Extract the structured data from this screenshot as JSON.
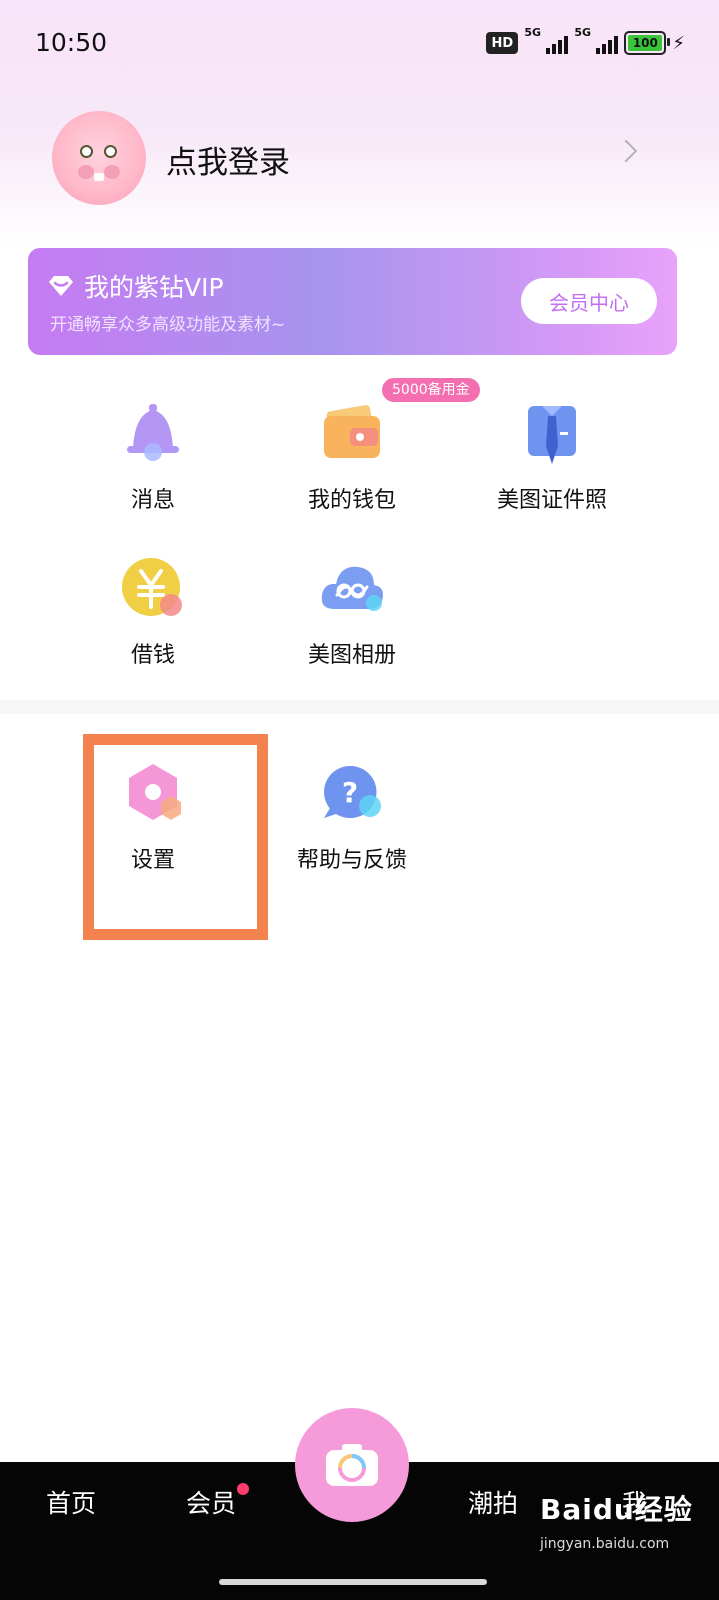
{
  "status_bar": {
    "time": "10:50",
    "hd": "HD",
    "net1": "5G",
    "net2": "5G",
    "battery": "100"
  },
  "profile": {
    "login_text": "点我登录"
  },
  "vip": {
    "title": "我的紫钻VIP",
    "subtitle": "开通畅享众多高级功能及素材~",
    "button": "会员中心"
  },
  "grid": {
    "wallet_badge": "5000备用金",
    "items": [
      {
        "label": "消息",
        "icon": "bell-icon"
      },
      {
        "label": "我的钱包",
        "icon": "wallet-icon"
      },
      {
        "label": "美图证件照",
        "icon": "id-photo-icon"
      },
      {
        "label": "借钱",
        "icon": "yen-coin-icon"
      },
      {
        "label": "美图相册",
        "icon": "cloud-album-icon"
      }
    ]
  },
  "tools": {
    "items": [
      {
        "label": "设置",
        "icon": "settings-icon"
      },
      {
        "label": "帮助与反馈",
        "icon": "help-icon"
      }
    ]
  },
  "bottom_nav": {
    "items": [
      "首页",
      "会员",
      "潮拍",
      "我"
    ]
  },
  "watermark": {
    "brand": "Baidu经验",
    "url": "jingyan.baidu.com"
  },
  "colors": {
    "accent_pink": "#f59bd9",
    "highlight_box": "#f4824f",
    "vip_purple": "#b98bf0"
  }
}
